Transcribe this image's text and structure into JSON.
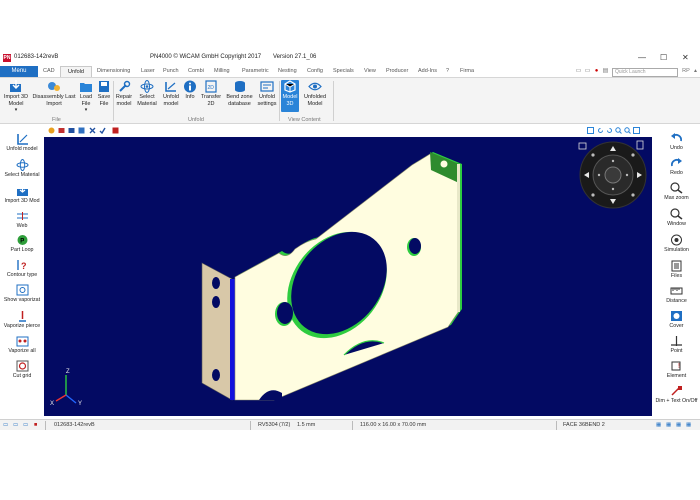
{
  "title_bar": {
    "doc_name": "012683-142revB",
    "app_title": "PN4000 © WiCAM GmbH Copyright 2017",
    "version": "Version 27.1_06",
    "minimize": "—",
    "maximize": "☐",
    "close": "✕"
  },
  "tabs": {
    "menu": "Menu",
    "items": [
      "CAD",
      "Unfold",
      "Dimensioning",
      "Laser",
      "Punch",
      "Combi",
      "Milling",
      "Parametric",
      "Nesting",
      "Config",
      "Specials",
      "View",
      "Producer",
      "Add-Ins",
      "?",
      "Firma"
    ],
    "quick_launch_placeholder": "Quick Launch",
    "user": "RP"
  },
  "ribbon": {
    "file_group": {
      "label": "File",
      "buttons": [
        "Import 3D Model",
        "Disassembly Last Import",
        "Load File",
        "Save File"
      ]
    },
    "unfold_group": {
      "label": "Unfold",
      "buttons": [
        "Repair model",
        "Select Material",
        "Unfold model",
        "Info",
        "Transfer 2D",
        "Bend zone database",
        "Unfold settings"
      ]
    },
    "view_group": {
      "label": "View Content",
      "buttons": [
        "Model 3D",
        "Unfolded Model"
      ]
    }
  },
  "left_panel": {
    "items": [
      "Unfold model",
      "Select Material",
      "Import 3D Mod",
      "Web",
      "Part Loop",
      "Contour type",
      "Show vaporizat",
      "Vaporize pierce",
      "Vaporize all",
      "Cut grid"
    ]
  },
  "right_panel": {
    "items": [
      "Undo",
      "Redo",
      "Max zoom",
      "Window",
      "Simulation",
      "Files",
      "Distance",
      "Cover",
      "Point",
      "Element",
      "Dim + Text On/Off"
    ]
  },
  "viewport": {
    "axis_x": "X",
    "axis_y": "Y",
    "axis_z": "Z",
    "background": "#030a63",
    "part_face": "#fffde0",
    "flange_color": "#d8c8a8",
    "edge_green": "#2ecc40",
    "edge_blue": "#1111dd"
  },
  "status_bar": {
    "doc_name": "012683-142revB",
    "material": "RV5304",
    "material_index": "(7/2)",
    "thickness": "1.5 mm",
    "dimensions": "116.00 x 16.00 x 70.00 mm",
    "face": "FACE 36",
    "bend": "BEND 2"
  }
}
